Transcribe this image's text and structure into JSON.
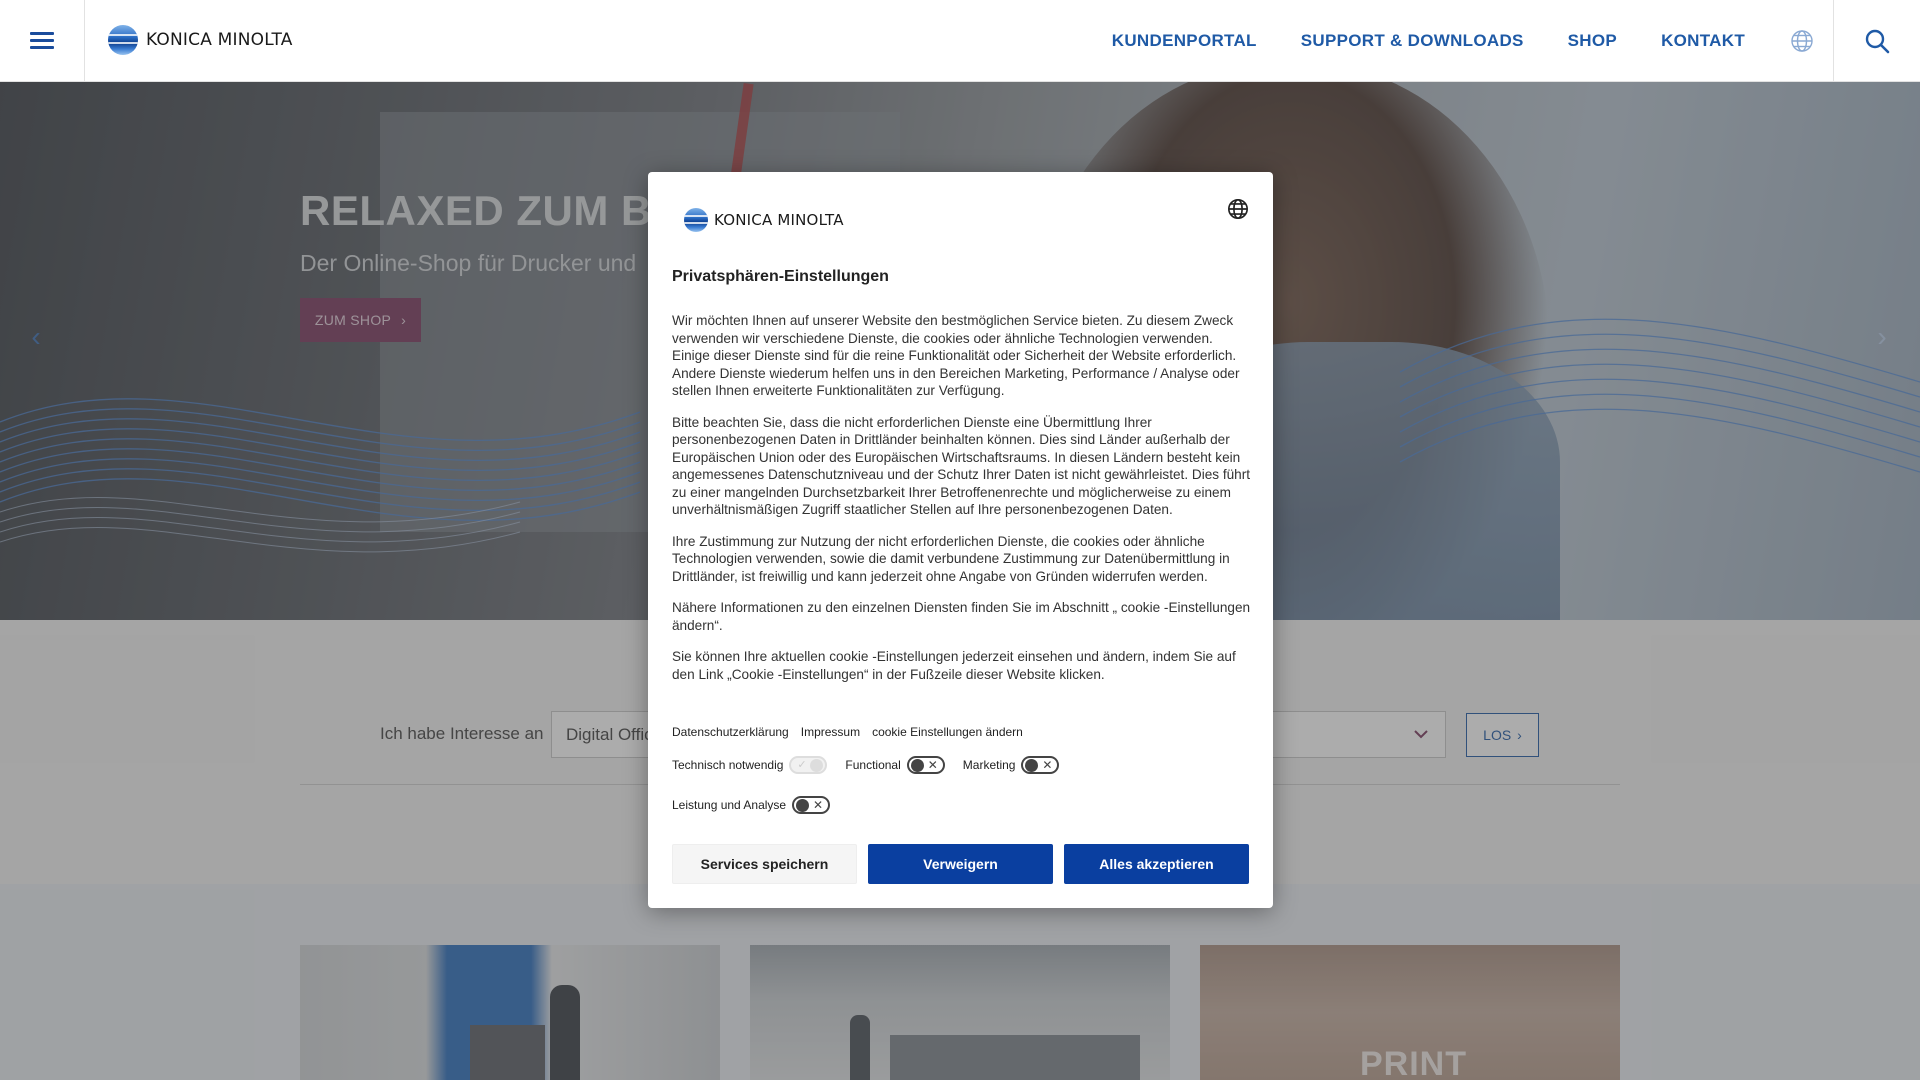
{
  "header": {
    "logo_text": "KONICA MINOLTA",
    "nav": [
      "KUNDENPORTAL",
      "SUPPORT & DOWNLOADS",
      "SHOP",
      "KONTAKT"
    ]
  },
  "hero": {
    "title": "RELAXED ZUM BÜR",
    "subtitle": "Der Online-Shop für Drucker und",
    "button_label": "ZUM SHOP",
    "arrow_left": "‹",
    "arrow_right": "›"
  },
  "interest": {
    "label": "Ich habe Interesse an",
    "selected": "Digital Offic",
    "button_label": "LOS"
  },
  "cards": {
    "card3_text": "PRINT"
  },
  "modal": {
    "logo_text": "KONICA MINOLTA",
    "title": "Privatsphären-Einstellungen",
    "paragraphs": [
      "Wir möchten Ihnen auf unserer Website den bestmöglichen Service bieten. Zu diesem Zweck verwenden wir verschiedene Dienste, die cookies oder ähnliche Technologien verwenden. Einige dieser Dienste sind für die reine Funktionalität oder Sicherheit der Website erforderlich. Andere Dienste wiederum helfen uns in den Bereichen Marketing, Performance / Analyse oder stellen Ihnen erweiterte Funktionalitäten zur Verfügung.",
      "Bitte beachten Sie, dass die nicht erforderlichen Dienste eine Übermittlung Ihrer personenbezogenen Daten in Drittländer beinhalten können. Dies sind Länder außerhalb der Europäischen Union oder des Europäischen Wirtschaftsraums. In diesen Ländern besteht kein angemessenes Datenschutzniveau und der Schutz Ihrer Daten ist nicht gewährleistet. Dies führt zu einer mangelnden Durchsetzbarkeit Ihrer Betroffenenrechte und möglicherweise zu einem unverhältnismäßigen Zugriff staatlicher Stellen auf Ihre personenbezogenen Daten.",
      "Ihre Zustimmung zur Nutzung der nicht erforderlichen Dienste, die cookies oder ähnliche Technologien verwenden, sowie die damit verbundene Zustimmung zur Datenübermittlung in Drittländer, ist freiwillig und kann jederzeit ohne Angabe von Gründen widerrufen werden.",
      "Nähere Informationen zu den einzelnen Diensten finden Sie im Abschnitt „ cookie -Einstellungen ändern“.",
      "Sie können Ihre aktuellen cookie -Einstellungen jederzeit einsehen und ändern, indem Sie auf den Link „Cookie -Einstellungen“ in der Fußzeile dieser Website klicken."
    ],
    "links": [
      "Datenschutzerklärung",
      "Impressum",
      "cookie Einstellungen ändern"
    ],
    "toggles": [
      {
        "label": "Technisch notwendig",
        "state": "disabled-on"
      },
      {
        "label": "Functional",
        "state": "off"
      },
      {
        "label": "Marketing",
        "state": "off"
      },
      {
        "label": "Leistung und Analyse",
        "state": "off"
      }
    ],
    "buttons": {
      "save": "Services speichern",
      "deny": "Verweigern",
      "accept": "Alles akzeptieren"
    }
  },
  "colors": {
    "brand_blue": "#1f5aa6",
    "button_blue": "#0a3fa0",
    "hero_button": "#7a3a5f"
  }
}
